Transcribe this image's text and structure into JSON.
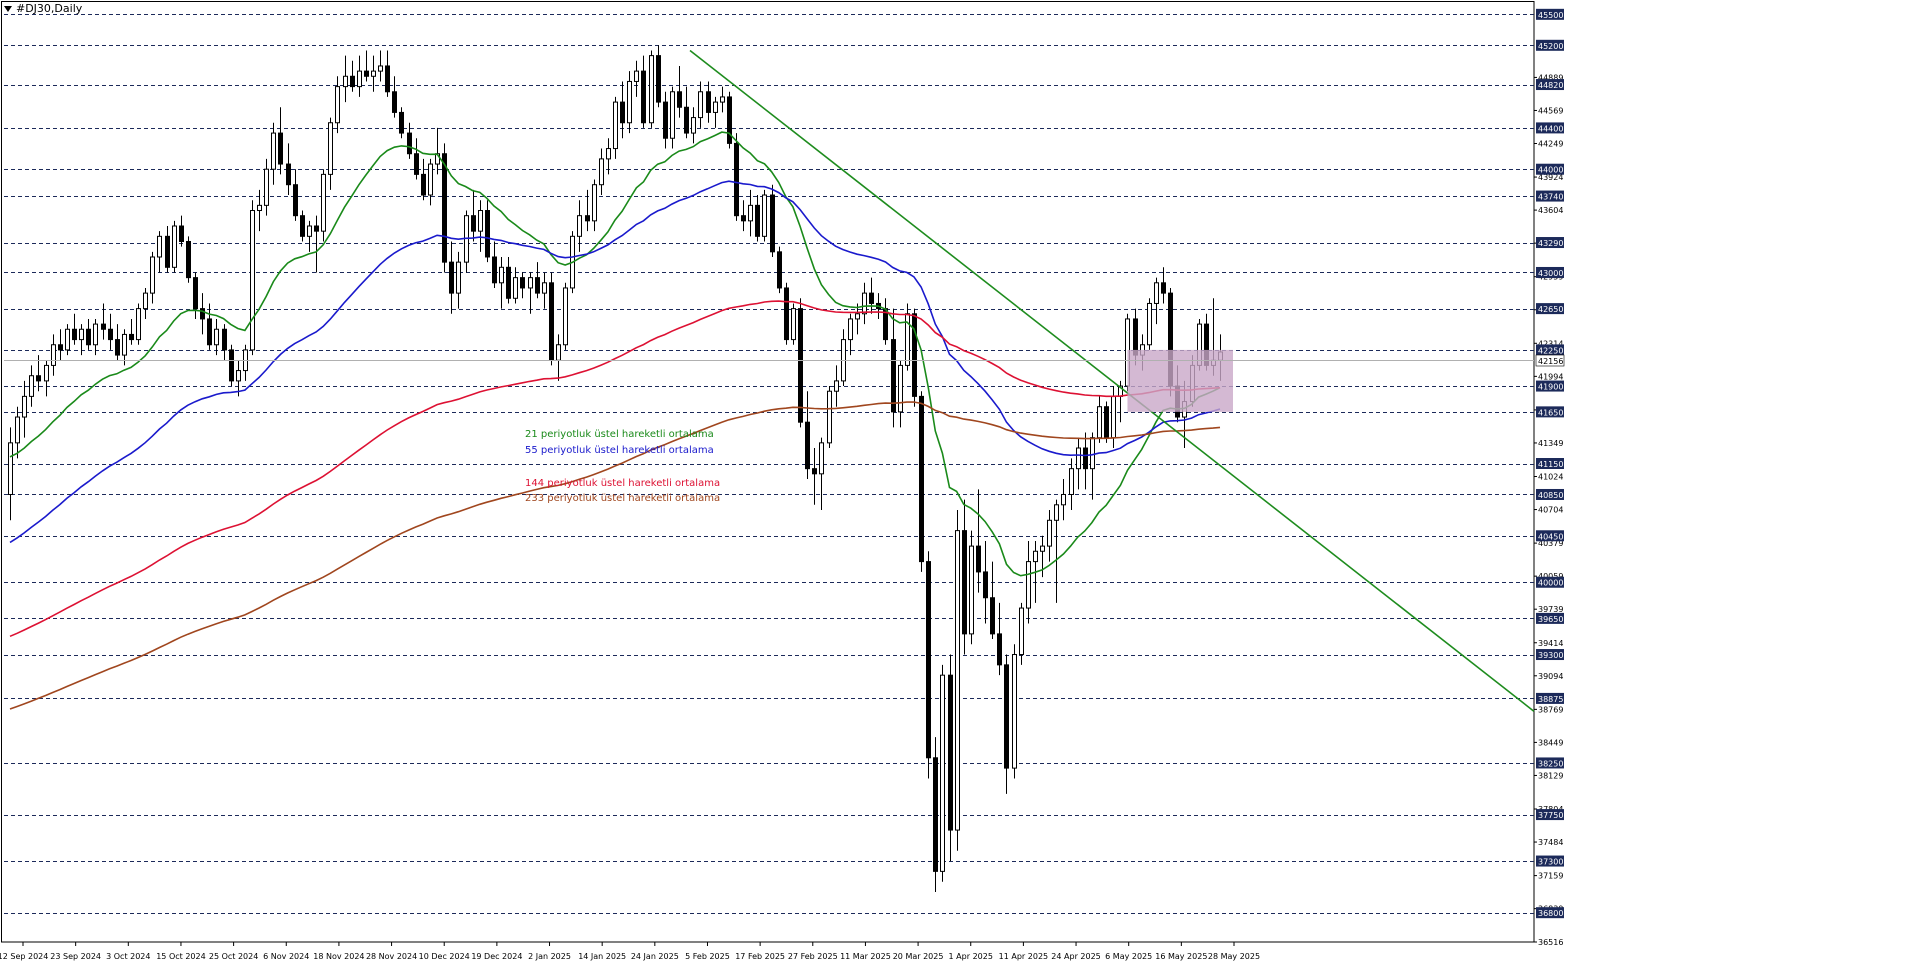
{
  "window": {
    "title": "#DJ30,Daily"
  },
  "chart_data": {
    "type": "candlestick",
    "symbol": "#DJ30",
    "timeframe": "Daily",
    "ylim": [
      36516,
      45600
    ],
    "grid": "horizontal dashed at key levels",
    "key_levels": [
      45500,
      45200,
      44820,
      44400,
      44000,
      43740,
      43290,
      43000,
      42650,
      42250,
      41900,
      41650,
      41150,
      40850,
      40450,
      40000,
      39650,
      39300,
      38875,
      38250,
      37750,
      37300,
      36800
    ],
    "minor_ticks": [
      44889,
      44569,
      44249,
      43924,
      43604,
      43284,
      42959,
      42639,
      42314,
      41994,
      41669,
      41349,
      41024,
      40704,
      40379,
      40059,
      39739,
      39414,
      39094,
      38769,
      38449,
      38129,
      37804,
      37484,
      37159,
      36839,
      36516
    ],
    "current_price": 42156,
    "x_labels": [
      "12 Sep 2024",
      "23 Sep 2024",
      "3 Oct 2024",
      "15 Oct 2024",
      "25 Oct 2024",
      "6 Nov 2024",
      "18 Nov 2024",
      "28 Nov 2024",
      "10 Dec 2024",
      "19 Dec 2024",
      "2 Jan 2025",
      "14 Jan 2025",
      "24 Jan 2025",
      "5 Feb 2025",
      "17 Feb 2025",
      "27 Feb 2025",
      "11 Mar 2025",
      "20 Mar 2025",
      "1 Apr 2025",
      "11 Apr 2025",
      "24 Apr 2025",
      "6 May 2025",
      "16 May 2025",
      "28 May 2025"
    ],
    "legend": [
      {
        "label": "21 periyotluk üstel hareketli ortalama",
        "color": "#1a8a1a"
      },
      {
        "label": "55 periyotluk üstel hareketli ortalama",
        "color": "#1a1acc"
      },
      {
        "label": "144 periyotluk üstel hareketli ortalama",
        "color": "#dd1133"
      },
      {
        "label": "233 periyotluk üstel hareketli ortalama",
        "color": "#a0461e"
      }
    ],
    "candles": [
      {
        "o": 40850,
        "h": 41500,
        "l": 40600,
        "c": 41350
      },
      {
        "o": 41350,
        "h": 41700,
        "l": 41200,
        "c": 41600
      },
      {
        "o": 41600,
        "h": 41950,
        "l": 41400,
        "c": 41800
      },
      {
        "o": 41800,
        "h": 42100,
        "l": 41700,
        "c": 42000
      },
      {
        "o": 42000,
        "h": 42200,
        "l": 41850,
        "c": 41950
      },
      {
        "o": 41950,
        "h": 42150,
        "l": 41800,
        "c": 42100
      },
      {
        "o": 42100,
        "h": 42400,
        "l": 42000,
        "c": 42300
      },
      {
        "o": 42300,
        "h": 42450,
        "l": 42150,
        "c": 42250
      },
      {
        "o": 42250,
        "h": 42500,
        "l": 42200,
        "c": 42450
      },
      {
        "o": 42450,
        "h": 42600,
        "l": 42300,
        "c": 42350
      },
      {
        "o": 42350,
        "h": 42500,
        "l": 42200,
        "c": 42450
      },
      {
        "o": 42450,
        "h": 42550,
        "l": 42250,
        "c": 42300
      },
      {
        "o": 42300,
        "h": 42550,
        "l": 42200,
        "c": 42500
      },
      {
        "o": 42500,
        "h": 42700,
        "l": 42350,
        "c": 42450
      },
      {
        "o": 42450,
        "h": 42600,
        "l": 42250,
        "c": 42350
      },
      {
        "o": 42350,
        "h": 42500,
        "l": 42150,
        "c": 42200
      },
      {
        "o": 42200,
        "h": 42450,
        "l": 42100,
        "c": 42400
      },
      {
        "o": 42400,
        "h": 42550,
        "l": 42300,
        "c": 42350
      },
      {
        "o": 42350,
        "h": 42700,
        "l": 42300,
        "c": 42650
      },
      {
        "o": 42650,
        "h": 42850,
        "l": 42550,
        "c": 42800
      },
      {
        "o": 42800,
        "h": 43200,
        "l": 42700,
        "c": 43150
      },
      {
        "o": 43150,
        "h": 43400,
        "l": 43000,
        "c": 43350
      },
      {
        "o": 43350,
        "h": 43450,
        "l": 43000,
        "c": 43050
      },
      {
        "o": 43050,
        "h": 43500,
        "l": 43000,
        "c": 43450
      },
      {
        "o": 43450,
        "h": 43550,
        "l": 43250,
        "c": 43300
      },
      {
        "o": 43300,
        "h": 43350,
        "l": 42900,
        "c": 42950
      },
      {
        "o": 42950,
        "h": 43000,
        "l": 42550,
        "c": 42650
      },
      {
        "o": 42650,
        "h": 42800,
        "l": 42400,
        "c": 42550
      },
      {
        "o": 42550,
        "h": 42700,
        "l": 42250,
        "c": 42300
      },
      {
        "o": 42300,
        "h": 42550,
        "l": 42200,
        "c": 42450
      },
      {
        "o": 42450,
        "h": 42500,
        "l": 42150,
        "c": 42250
      },
      {
        "o": 42250,
        "h": 42300,
        "l": 41900,
        "c": 41950
      },
      {
        "o": 41950,
        "h": 42150,
        "l": 41800,
        "c": 42050
      },
      {
        "o": 42050,
        "h": 42300,
        "l": 41950,
        "c": 42250
      },
      {
        "o": 42250,
        "h": 43700,
        "l": 42200,
        "c": 43600
      },
      {
        "o": 43600,
        "h": 43800,
        "l": 43400,
        "c": 43650
      },
      {
        "o": 43650,
        "h": 44100,
        "l": 43550,
        "c": 44000
      },
      {
        "o": 44000,
        "h": 44450,
        "l": 43850,
        "c": 44350
      },
      {
        "o": 44350,
        "h": 44600,
        "l": 43950,
        "c": 44050
      },
      {
        "o": 44050,
        "h": 44250,
        "l": 43750,
        "c": 43850
      },
      {
        "o": 43850,
        "h": 44000,
        "l": 43500,
        "c": 43550
      },
      {
        "o": 43550,
        "h": 43600,
        "l": 43300,
        "c": 43350
      },
      {
        "o": 43350,
        "h": 43500,
        "l": 43200,
        "c": 43450
      },
      {
        "o": 43450,
        "h": 43550,
        "l": 43000,
        "c": 43400
      },
      {
        "o": 43400,
        "h": 44000,
        "l": 43300,
        "c": 43950
      },
      {
        "o": 43950,
        "h": 44500,
        "l": 43800,
        "c": 44450
      },
      {
        "o": 44450,
        "h": 44900,
        "l": 44350,
        "c": 44800
      },
      {
        "o": 44800,
        "h": 45100,
        "l": 44650,
        "c": 44900
      },
      {
        "o": 44900,
        "h": 45050,
        "l": 44750,
        "c": 44800
      },
      {
        "o": 44800,
        "h": 45100,
        "l": 44700,
        "c": 44950
      },
      {
        "o": 44950,
        "h": 45150,
        "l": 44850,
        "c": 44900
      },
      {
        "o": 44900,
        "h": 45100,
        "l": 44750,
        "c": 44950
      },
      {
        "o": 44950,
        "h": 45150,
        "l": 44850,
        "c": 45000
      },
      {
        "o": 45000,
        "h": 45150,
        "l": 44700,
        "c": 44750
      },
      {
        "o": 44750,
        "h": 44900,
        "l": 44500,
        "c": 44550
      },
      {
        "o": 44550,
        "h": 44600,
        "l": 44300,
        "c": 44350
      },
      {
        "o": 44350,
        "h": 44450,
        "l": 44100,
        "c": 44150
      },
      {
        "o": 44150,
        "h": 44300,
        "l": 43900,
        "c": 43950
      },
      {
        "o": 43950,
        "h": 44100,
        "l": 43700,
        "c": 43750
      },
      {
        "o": 43750,
        "h": 44100,
        "l": 43650,
        "c": 44050
      },
      {
        "o": 44050,
        "h": 44400,
        "l": 43950,
        "c": 44150
      },
      {
        "o": 44150,
        "h": 44250,
        "l": 43000,
        "c": 43100
      },
      {
        "o": 43100,
        "h": 43300,
        "l": 42600,
        "c": 42800
      },
      {
        "o": 42800,
        "h": 43200,
        "l": 42650,
        "c": 43100
      },
      {
        "o": 43100,
        "h": 43600,
        "l": 43000,
        "c": 43550
      },
      {
        "o": 43550,
        "h": 43800,
        "l": 43300,
        "c": 43400
      },
      {
        "o": 43400,
        "h": 43700,
        "l": 43200,
        "c": 43600
      },
      {
        "o": 43600,
        "h": 43700,
        "l": 43100,
        "c": 43150
      },
      {
        "o": 43150,
        "h": 43300,
        "l": 42850,
        "c": 42900
      },
      {
        "o": 42900,
        "h": 43150,
        "l": 42650,
        "c": 43050
      },
      {
        "o": 43050,
        "h": 43150,
        "l": 42700,
        "c": 42750
      },
      {
        "o": 42750,
        "h": 43050,
        "l": 42700,
        "c": 42950
      },
      {
        "o": 42950,
        "h": 43000,
        "l": 42750,
        "c": 42850
      },
      {
        "o": 42850,
        "h": 43000,
        "l": 42600,
        "c": 42950
      },
      {
        "o": 42950,
        "h": 43100,
        "l": 42750,
        "c": 42800
      },
      {
        "o": 42800,
        "h": 43000,
        "l": 42650,
        "c": 42900
      },
      {
        "o": 42900,
        "h": 43000,
        "l": 42100,
        "c": 42150
      },
      {
        "o": 42150,
        "h": 42400,
        "l": 41950,
        "c": 42300
      },
      {
        "o": 42300,
        "h": 42900,
        "l": 42250,
        "c": 42850
      },
      {
        "o": 42850,
        "h": 43400,
        "l": 42800,
        "c": 43350
      },
      {
        "o": 43350,
        "h": 43700,
        "l": 43200,
        "c": 43550
      },
      {
        "o": 43550,
        "h": 43800,
        "l": 43400,
        "c": 43500
      },
      {
        "o": 43500,
        "h": 43900,
        "l": 43400,
        "c": 43850
      },
      {
        "o": 43850,
        "h": 44200,
        "l": 43750,
        "c": 44100
      },
      {
        "o": 44100,
        "h": 44300,
        "l": 43950,
        "c": 44200
      },
      {
        "o": 44200,
        "h": 44700,
        "l": 44100,
        "c": 44650
      },
      {
        "o": 44650,
        "h": 44850,
        "l": 44300,
        "c": 44450
      },
      {
        "o": 44450,
        "h": 44950,
        "l": 44350,
        "c": 44850
      },
      {
        "o": 44850,
        "h": 45050,
        "l": 44700,
        "c": 44950
      },
      {
        "o": 44950,
        "h": 45100,
        "l": 44400,
        "c": 44450
      },
      {
        "o": 44450,
        "h": 45150,
        "l": 44400,
        "c": 45100
      },
      {
        "o": 45100,
        "h": 45200,
        "l": 44600,
        "c": 44650
      },
      {
        "o": 44650,
        "h": 44750,
        "l": 44200,
        "c": 44300
      },
      {
        "o": 44300,
        "h": 44800,
        "l": 44200,
        "c": 44750
      },
      {
        "o": 44750,
        "h": 45000,
        "l": 44500,
        "c": 44600
      },
      {
        "o": 44600,
        "h": 44800,
        "l": 44300,
        "c": 44350
      },
      {
        "o": 44350,
        "h": 44600,
        "l": 44250,
        "c": 44500
      },
      {
        "o": 44500,
        "h": 44850,
        "l": 44400,
        "c": 44750
      },
      {
        "o": 44750,
        "h": 44850,
        "l": 44450,
        "c": 44550
      },
      {
        "o": 44550,
        "h": 44700,
        "l": 44400,
        "c": 44650
      },
      {
        "o": 44650,
        "h": 44800,
        "l": 44550,
        "c": 44700
      },
      {
        "o": 44700,
        "h": 44750,
        "l": 44200,
        "c": 44250
      },
      {
        "o": 44250,
        "h": 44350,
        "l": 43500,
        "c": 43550
      },
      {
        "o": 43550,
        "h": 43700,
        "l": 43400,
        "c": 43500
      },
      {
        "o": 43500,
        "h": 43800,
        "l": 43350,
        "c": 43650
      },
      {
        "o": 43650,
        "h": 43750,
        "l": 43300,
        "c": 43350
      },
      {
        "o": 43350,
        "h": 43800,
        "l": 43300,
        "c": 43750
      },
      {
        "o": 43750,
        "h": 43850,
        "l": 43150,
        "c": 43200
      },
      {
        "o": 43200,
        "h": 43250,
        "l": 42800,
        "c": 42850
      },
      {
        "o": 42850,
        "h": 42900,
        "l": 42300,
        "c": 42350
      },
      {
        "o": 42350,
        "h": 42700,
        "l": 42300,
        "c": 42650
      },
      {
        "o": 42650,
        "h": 42750,
        "l": 41500,
        "c": 41550
      },
      {
        "o": 41550,
        "h": 41850,
        "l": 41000,
        "c": 41100
      },
      {
        "o": 41100,
        "h": 41300,
        "l": 40750,
        "c": 41050
      },
      {
        "o": 41050,
        "h": 41400,
        "l": 40700,
        "c": 41350
      },
      {
        "o": 41350,
        "h": 41900,
        "l": 41300,
        "c": 41850
      },
      {
        "o": 41850,
        "h": 42100,
        "l": 41700,
        "c": 41950
      },
      {
        "o": 41950,
        "h": 42450,
        "l": 41900,
        "c": 42350
      },
      {
        "o": 42350,
        "h": 42600,
        "l": 42200,
        "c": 42550
      },
      {
        "o": 42550,
        "h": 42700,
        "l": 42400,
        "c": 42600
      },
      {
        "o": 42600,
        "h": 42900,
        "l": 42500,
        "c": 42800
      },
      {
        "o": 42800,
        "h": 42950,
        "l": 42600,
        "c": 42700
      },
      {
        "o": 42700,
        "h": 42800,
        "l": 42550,
        "c": 42650
      },
      {
        "o": 42650,
        "h": 42750,
        "l": 42300,
        "c": 42350
      },
      {
        "o": 42350,
        "h": 42650,
        "l": 41500,
        "c": 41650
      },
      {
        "o": 41650,
        "h": 42150,
        "l": 41500,
        "c": 42100
      },
      {
        "o": 42100,
        "h": 42700,
        "l": 42050,
        "c": 42600
      },
      {
        "o": 42600,
        "h": 42650,
        "l": 41700,
        "c": 41800
      },
      {
        "o": 41800,
        "h": 41850,
        "l": 40100,
        "c": 40200
      },
      {
        "o": 40200,
        "h": 40300,
        "l": 38100,
        "c": 38300
      },
      {
        "o": 38300,
        "h": 38500,
        "l": 37000,
        "c": 37200
      },
      {
        "o": 37200,
        "h": 39200,
        "l": 37100,
        "c": 39100
      },
      {
        "o": 39100,
        "h": 39300,
        "l": 37300,
        "c": 37600
      },
      {
        "o": 37600,
        "h": 40700,
        "l": 37400,
        "c": 40500
      },
      {
        "o": 40500,
        "h": 40800,
        "l": 39300,
        "c": 39500
      },
      {
        "o": 39500,
        "h": 40500,
        "l": 39400,
        "c": 40350
      },
      {
        "o": 40350,
        "h": 40900,
        "l": 39900,
        "c": 40100
      },
      {
        "o": 40100,
        "h": 40400,
        "l": 39600,
        "c": 39850
      },
      {
        "o": 39850,
        "h": 40200,
        "l": 39450,
        "c": 39500
      },
      {
        "o": 39500,
        "h": 39800,
        "l": 39100,
        "c": 39200
      },
      {
        "o": 39200,
        "h": 39300,
        "l": 37950,
        "c": 38200
      },
      {
        "o": 38200,
        "h": 39400,
        "l": 38100,
        "c": 39300
      },
      {
        "o": 39300,
        "h": 39800,
        "l": 39200,
        "c": 39750
      },
      {
        "o": 39750,
        "h": 40400,
        "l": 39600,
        "c": 40200
      },
      {
        "o": 40200,
        "h": 40400,
        "l": 39800,
        "c": 40300
      },
      {
        "o": 40300,
        "h": 40450,
        "l": 40050,
        "c": 40350
      },
      {
        "o": 40350,
        "h": 40700,
        "l": 40200,
        "c": 40600
      },
      {
        "o": 40600,
        "h": 40800,
        "l": 39800,
        "c": 40750
      },
      {
        "o": 40750,
        "h": 41000,
        "l": 40600,
        "c": 40850
      },
      {
        "o": 40850,
        "h": 41200,
        "l": 40700,
        "c": 41100
      },
      {
        "o": 41100,
        "h": 41400,
        "l": 40900,
        "c": 41300
      },
      {
        "o": 41300,
        "h": 41450,
        "l": 40900,
        "c": 41100
      },
      {
        "o": 41100,
        "h": 41450,
        "l": 40800,
        "c": 41400
      },
      {
        "o": 41400,
        "h": 41800,
        "l": 41350,
        "c": 41700
      },
      {
        "o": 41700,
        "h": 41750,
        "l": 41350,
        "c": 41400
      },
      {
        "o": 41400,
        "h": 41900,
        "l": 41300,
        "c": 41800
      },
      {
        "o": 41800,
        "h": 41950,
        "l": 41550,
        "c": 41900
      },
      {
        "o": 41900,
        "h": 42600,
        "l": 41850,
        "c": 42550
      },
      {
        "o": 42550,
        "h": 42650,
        "l": 42100,
        "c": 42200
      },
      {
        "o": 42200,
        "h": 42400,
        "l": 42050,
        "c": 42300
      },
      {
        "o": 42300,
        "h": 42750,
        "l": 42250,
        "c": 42700
      },
      {
        "o": 42700,
        "h": 42950,
        "l": 42500,
        "c": 42900
      },
      {
        "o": 42900,
        "h": 43050,
        "l": 42700,
        "c": 42800
      },
      {
        "o": 42800,
        "h": 42850,
        "l": 41800,
        "c": 41900
      },
      {
        "o": 41900,
        "h": 42100,
        "l": 41550,
        "c": 41600
      },
      {
        "o": 41600,
        "h": 41950,
        "l": 41300,
        "c": 41750
      },
      {
        "o": 41750,
        "h": 42200,
        "l": 41700,
        "c": 42100
      },
      {
        "o": 42100,
        "h": 42550,
        "l": 42050,
        "c": 42500
      },
      {
        "o": 42500,
        "h": 42600,
        "l": 42050,
        "c": 42100
      },
      {
        "o": 42100,
        "h": 42750,
        "l": 42000,
        "c": 42150
      },
      {
        "o": 42150,
        "h": 42400,
        "l": 41950,
        "c": 42230
      }
    ]
  }
}
